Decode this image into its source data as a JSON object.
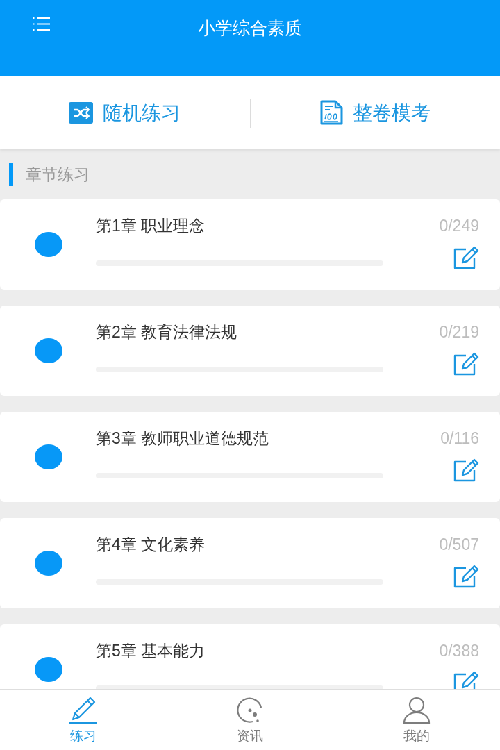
{
  "header": {
    "title": "小学综合素质"
  },
  "quick_actions": [
    {
      "label": "随机练习",
      "kind": "shuffle"
    },
    {
      "label": "整卷模考",
      "kind": "exam"
    }
  ],
  "section": {
    "title": "章节练习"
  },
  "chapters": [
    {
      "title": "第1章 职业理念",
      "count": "0/249"
    },
    {
      "title": "第2章 教育法律法规",
      "count": "0/219"
    },
    {
      "title": "第3章 教师职业道德规范",
      "count": "0/116"
    },
    {
      "title": "第4章 文化素养",
      "count": "0/507"
    },
    {
      "title": "第5章 基本能力",
      "count": "0/388"
    }
  ],
  "tab_bar": [
    {
      "label": "练习",
      "kind": "practice",
      "selected": true
    },
    {
      "label": "资讯",
      "kind": "news",
      "selected": false
    },
    {
      "label": "我的",
      "kind": "profile",
      "selected": false
    }
  ]
}
